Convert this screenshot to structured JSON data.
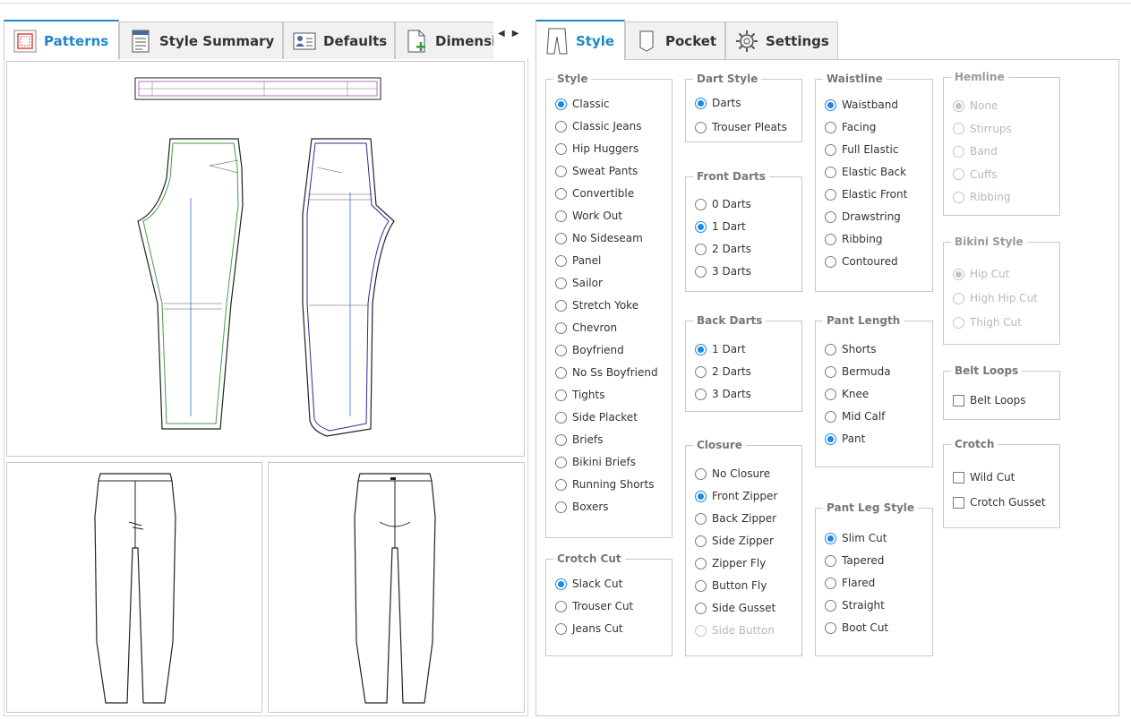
{
  "left_tabs": [
    {
      "label": "Patterns",
      "icon": "pattern-icon",
      "active": true
    },
    {
      "label": "Style Summary",
      "icon": "document-icon",
      "active": false
    },
    {
      "label": "Defaults",
      "icon": "user-card-icon",
      "active": false
    },
    {
      "label": "Dimensi",
      "icon": "add-document-icon",
      "active": false
    }
  ],
  "right_tabs": [
    {
      "label": "Style",
      "icon": "pants-icon",
      "active": true
    },
    {
      "label": "Pocket",
      "icon": "pocket-icon",
      "active": false
    },
    {
      "label": "Settings",
      "icon": "gear-icon",
      "active": false
    }
  ],
  "accent_color": "#1e88c7",
  "radio_color": "#1e88e5",
  "groups": {
    "style": {
      "title": "Style",
      "options": [
        "Classic",
        "Classic Jeans",
        "Hip Huggers",
        "Sweat Pants",
        "Convertible",
        "Work Out",
        "No Sideseam",
        "Panel",
        "Sailor",
        "Stretch Yoke",
        "Chevron",
        "Boyfriend",
        "No Ss Boyfriend",
        "Tights",
        "Side Placket",
        "Briefs",
        "Bikini Briefs",
        "Running Shorts",
        "Boxers"
      ],
      "selected": "Classic"
    },
    "crotch_cut": {
      "title": "Crotch Cut",
      "options": [
        "Slack Cut",
        "Trouser Cut",
        "Jeans Cut"
      ],
      "selected": "Slack Cut"
    },
    "dart_style": {
      "title": "Dart Style",
      "options": [
        "Darts",
        "Trouser Pleats"
      ],
      "selected": "Darts"
    },
    "front_darts": {
      "title": "Front Darts",
      "options": [
        "0 Darts",
        "1 Dart",
        "2 Darts",
        "3 Darts"
      ],
      "selected": "1 Dart"
    },
    "back_darts": {
      "title": "Back Darts",
      "options": [
        "1 Dart",
        "2 Darts",
        "3 Darts"
      ],
      "selected": "1 Dart"
    },
    "closure": {
      "title": "Closure",
      "options": [
        "No Closure",
        "Front Zipper",
        "Back Zipper",
        "Side Zipper",
        "Zipper Fly",
        "Button Fly",
        "Side Gusset",
        "Side Button"
      ],
      "selected": "Front Zipper",
      "disabled": [
        "Side Button"
      ]
    },
    "waistline": {
      "title": "Waistline",
      "options": [
        "Waistband",
        "Facing",
        "Full Elastic",
        "Elastic Back",
        "Elastic Front",
        "Drawstring",
        "Ribbing",
        "Contoured"
      ],
      "selected": "Waistband"
    },
    "pant_length": {
      "title": "Pant Length",
      "options": [
        "Shorts",
        "Bermuda",
        "Knee",
        "Mid Calf",
        "Pant"
      ],
      "selected": "Pant"
    },
    "pant_leg_style": {
      "title": "Pant Leg Style",
      "options": [
        "Slim Cut",
        "Tapered",
        "Flared",
        "Straight",
        "Boot Cut"
      ],
      "selected": "Slim Cut"
    },
    "hemline": {
      "title": "Hemline",
      "options": [
        "None",
        "Stirrups",
        "Band",
        "Cuffs",
        "Ribbing"
      ],
      "selected": "None",
      "group_disabled": true
    },
    "bikini_style": {
      "title": "Bikini Style",
      "options": [
        "Hip Cut",
        "High Hip Cut",
        "Thigh Cut"
      ],
      "selected": "Hip Cut",
      "group_disabled": true
    },
    "belt_loops": {
      "title": "Belt Loops",
      "checkboxes": [
        "Belt Loops"
      ]
    },
    "crotch": {
      "title": "Crotch",
      "checkboxes": [
        "Wild Cut",
        "Crotch Gusset"
      ]
    }
  }
}
